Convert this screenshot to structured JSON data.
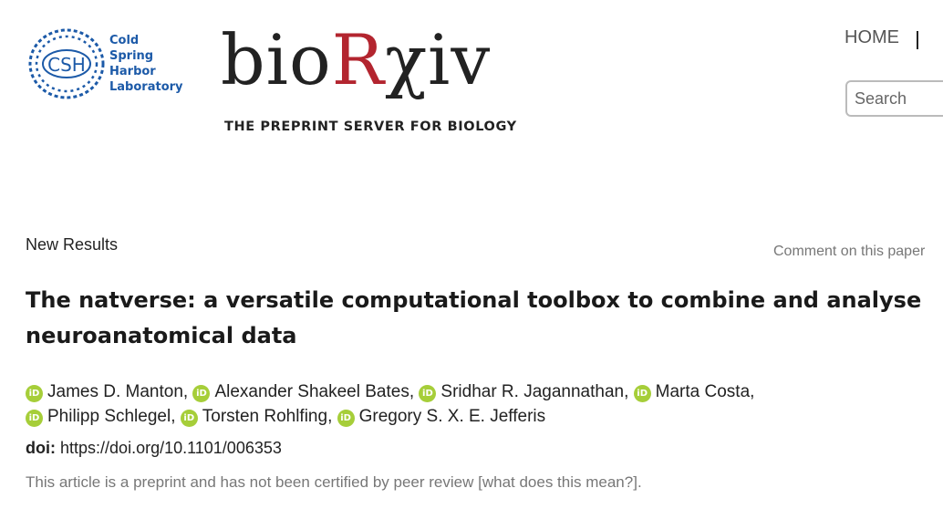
{
  "header": {
    "csh_logo": {
      "badge": "CSH",
      "lines": [
        "Cold",
        "Spring",
        "Harbor",
        "Laboratory"
      ]
    },
    "wordmark": {
      "part1": "bio",
      "part2": "R",
      "part3": "χiv"
    },
    "tagline": "THE PREPRINT SERVER FOR BIOLOGY",
    "nav_home": "HOME",
    "search_placeholder": "Search"
  },
  "article": {
    "section": "New Results",
    "comment_link": "Comment on this paper",
    "title": "The natverse: a versatile computational toolbox to combine and analyse neuroanatomical data",
    "authors": [
      "James D. Manton",
      "Alexander Shakeel Bates",
      "Sridhar R. Jagannathan",
      "Marta Costa",
      "Philipp Schlegel",
      "Torsten Rohlfing",
      "Gregory S. X. E. Jefferis"
    ],
    "orcid_badge": "iD",
    "doi_label": "doi:",
    "doi_value": "https://doi.org/10.1101/006353",
    "disclaimer_text": "This article is a preprint and has not been certified by peer review",
    "disclaimer_link": "[what does this mean?]",
    "disclaimer_end": "."
  },
  "colors": {
    "brand_red": "#b3252f",
    "csh_blue": "#1c5aa8",
    "orcid_green": "#a6ce39"
  }
}
